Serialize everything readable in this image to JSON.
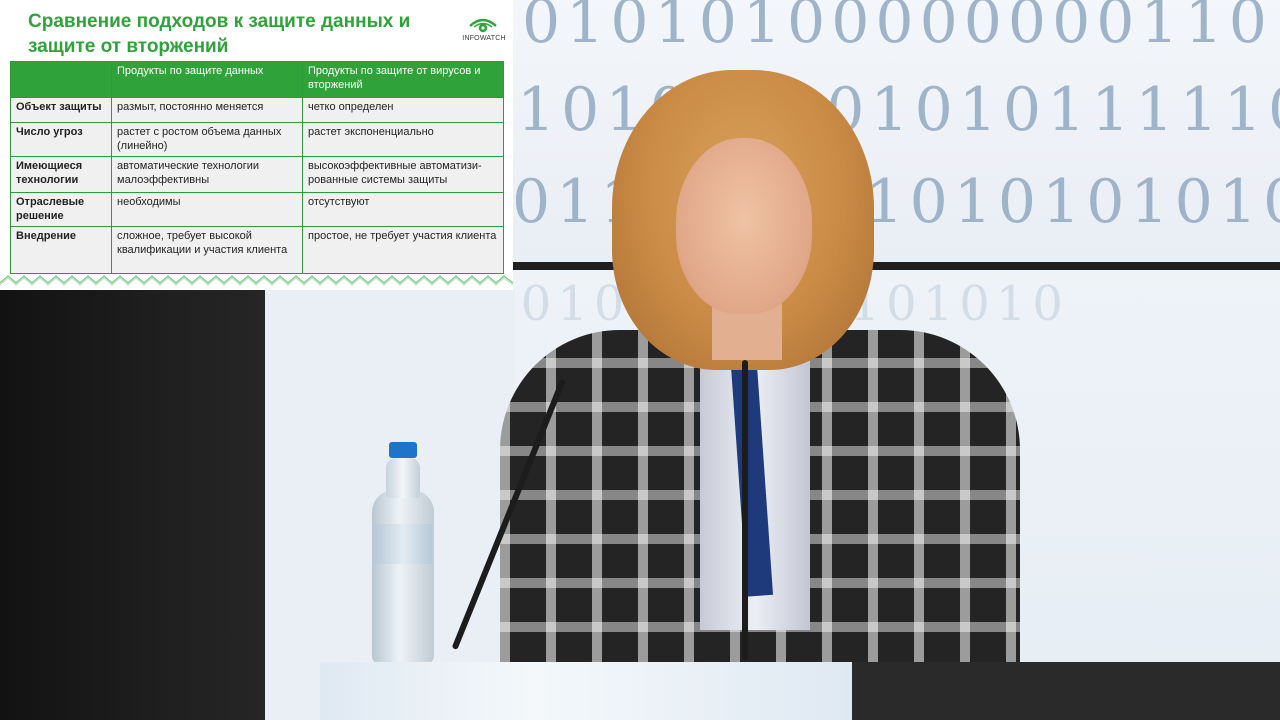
{
  "slide": {
    "title_line1": "Сравнение подходов к защите данных и",
    "title_line2": "защите от вторжений",
    "logo": {
      "icon": "eye-icon",
      "text": "INFOWATCH",
      "color": "#2fa33a"
    },
    "accent_color": "#2fa33a",
    "table": {
      "headers": [
        "",
        "Продукты по защите данных",
        "Продукты по защите от вирусов и вторжений"
      ],
      "rows": [
        {
          "label": "Объект защиты",
          "data": "размыт, постоянно меняется",
          "intrusion": "четко определен"
        },
        {
          "label": "Число угроз",
          "data": "растет с ростом объема данных (линейно)",
          "intrusion": "растет экспоненциально"
        },
        {
          "label": "Имеющиеся технологии",
          "data": "автоматические технологии малоэффективны",
          "intrusion": "высокоэффективные автоматизи-рованные системы защиты"
        },
        {
          "label": "Отраслевые решение",
          "data": "необходимы",
          "intrusion": "отсутствуют"
        },
        {
          "label": "Внедрение",
          "data": "сложное, требует высокой квалификации и участия клиента",
          "intrusion": "простое,  не требует участия клиента"
        }
      ]
    }
  }
}
